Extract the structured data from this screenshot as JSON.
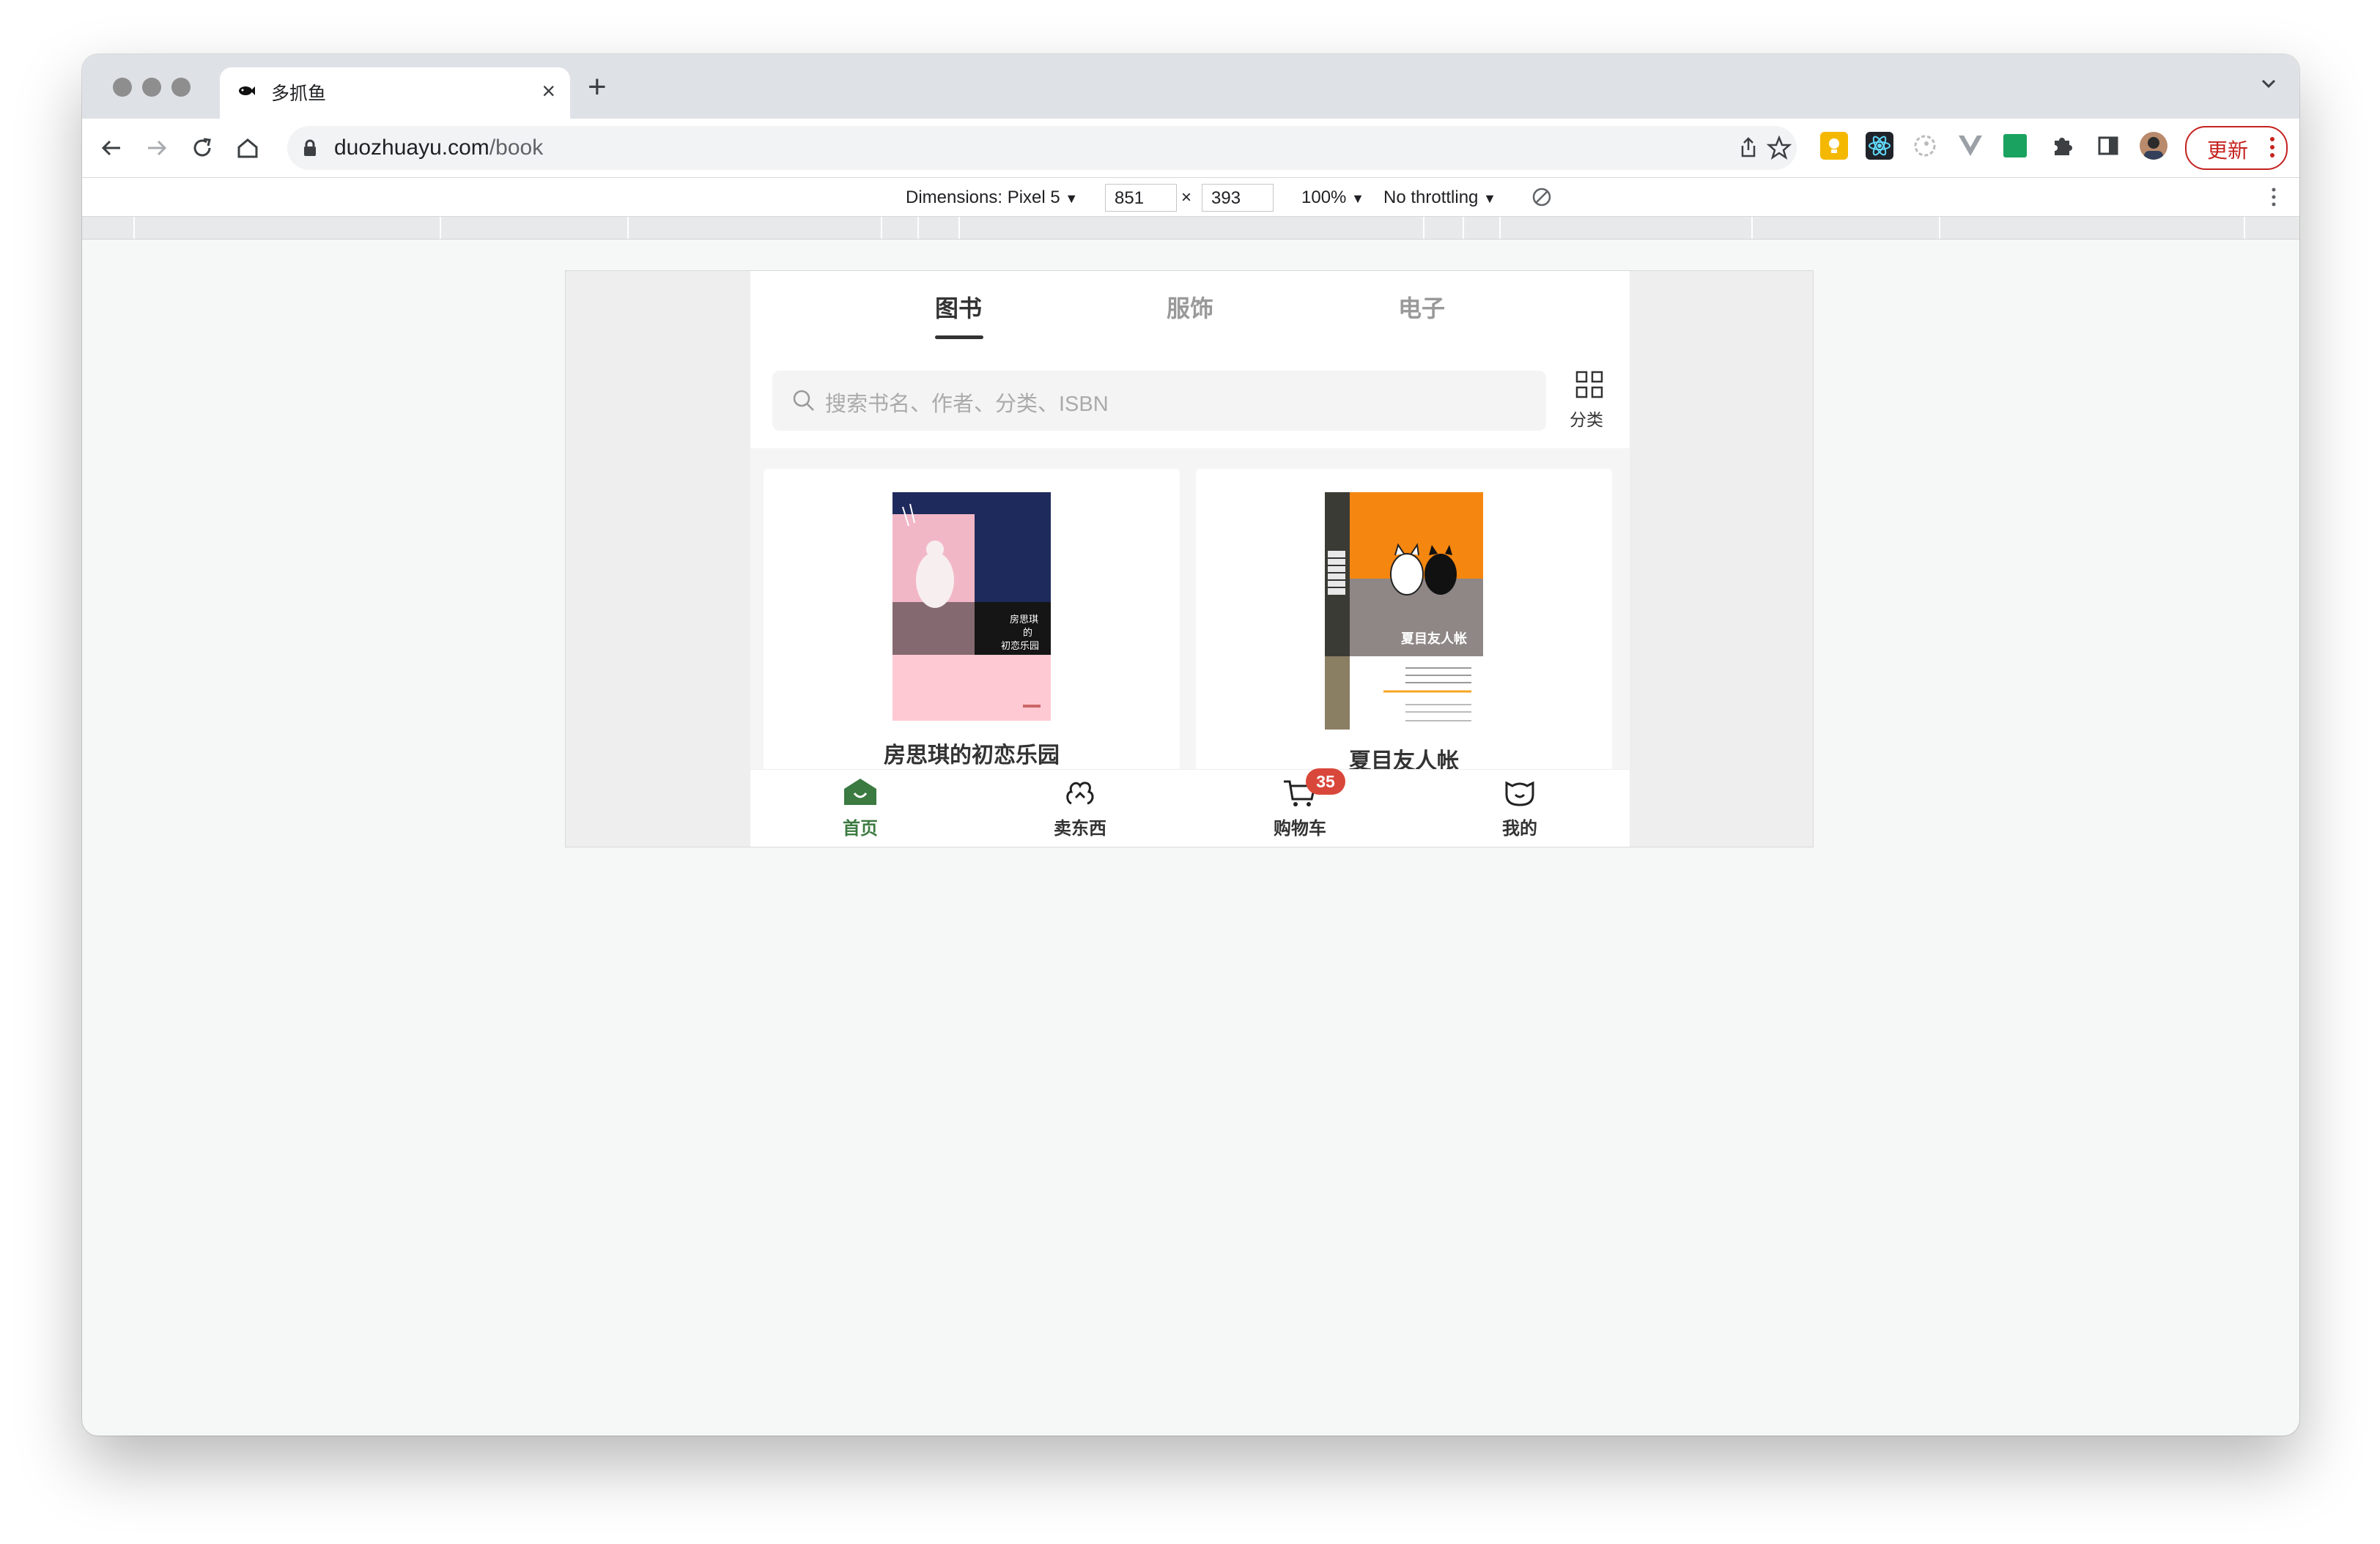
{
  "browser": {
    "tab_title": "多抓鱼",
    "tab_close": "×",
    "new_tab": "+",
    "url_host": "duozhuayu.com",
    "url_path": "/book",
    "update_label": "更新"
  },
  "devtools": {
    "dimensions_label": "Dimensions: Pixel 5",
    "width_value": "851",
    "times": "×",
    "height_value": "393",
    "zoom": "100%",
    "throttle": "No throttling",
    "dropdown_glyph": "▼"
  },
  "app": {
    "tabs": [
      {
        "label": "图书",
        "active": true
      },
      {
        "label": "服饰",
        "active": false
      },
      {
        "label": "电子",
        "active": false
      }
    ],
    "search_placeholder": "搜索书名、作者、分类、ISBN",
    "category_label": "分类",
    "books": [
      {
        "title": "房思琪的初恋乐园",
        "cover_text": "房思琪\n的\n初恋乐园"
      },
      {
        "title": "夏目友人帐",
        "cover_text": "夏目友人帐"
      }
    ],
    "tabbar": [
      {
        "label": "首页",
        "icon": "home-icon",
        "active": true
      },
      {
        "label": "卖东西",
        "icon": "sell-icon",
        "active": false
      },
      {
        "label": "购物车",
        "icon": "cart-icon",
        "active": false,
        "badge": "35"
      },
      {
        "label": "我的",
        "icon": "profile-icon",
        "active": false
      }
    ]
  },
  "colors": {
    "accent_green": "#3b7a41",
    "badge_red": "#d9473a",
    "update_red": "#c5221f"
  }
}
